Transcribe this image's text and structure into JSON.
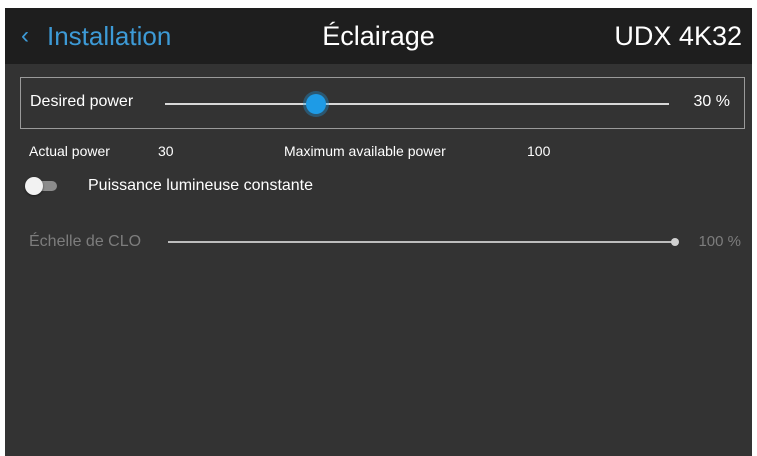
{
  "header": {
    "back_label": "Installation",
    "back_icon": "chevron-left-icon",
    "title": "Éclairage",
    "model": "UDX 4K32"
  },
  "desired_power": {
    "label": "Desired power",
    "value": 30,
    "value_text": "30 %",
    "accent_color": "#1e9be6"
  },
  "info": {
    "actual_label": "Actual power",
    "actual_value": "30",
    "max_label": "Maximum available power",
    "max_value": "100"
  },
  "constant_light": {
    "label": "Puissance lumineuse constante",
    "enabled": false
  },
  "clo_scale": {
    "label": "Échelle de CLO",
    "value": 100,
    "value_text": "100 %",
    "disabled": true
  },
  "colors": {
    "accent": "#3d9ad6",
    "header_bg": "#1e1e1e",
    "panel_bg": "#333333"
  }
}
